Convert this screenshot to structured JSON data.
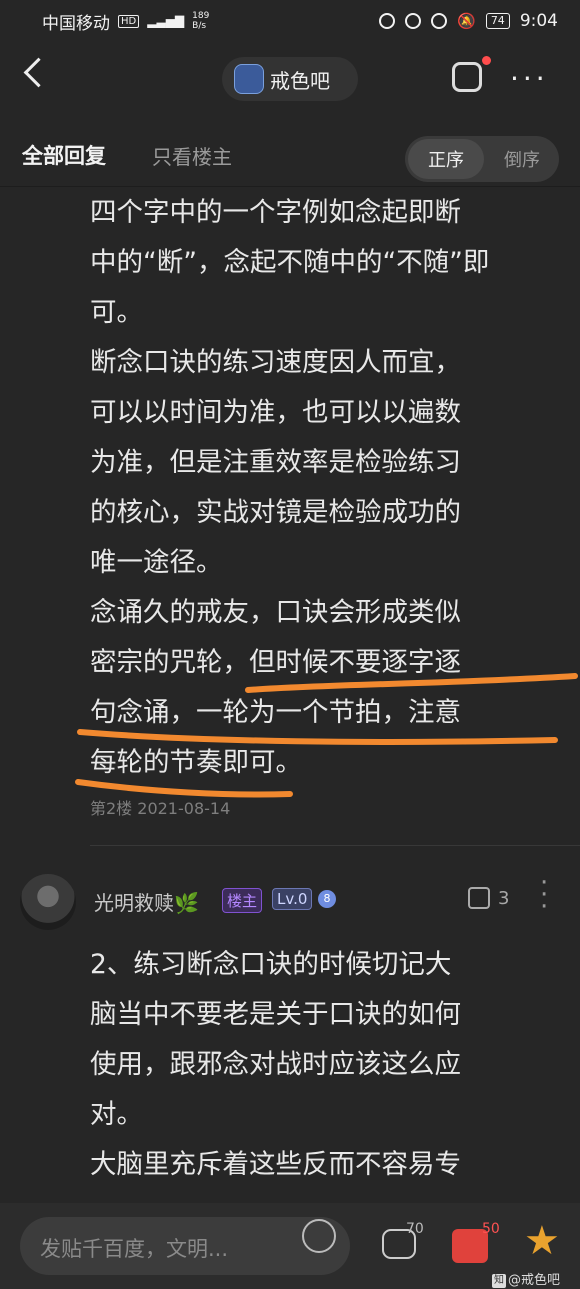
{
  "status_bar": {
    "carrier": "中国移动",
    "hd": "HD",
    "network_speed": "189",
    "network_unit": "B/s",
    "battery": "74",
    "time": "9:04"
  },
  "header": {
    "forum_name": "戒色吧"
  },
  "tabs": {
    "all_replies": "全部回复",
    "op_only": "只看楼主",
    "order_asc": "正序",
    "order_desc": "倒序"
  },
  "post_floor_2": {
    "text": "四个字中的一个字例如念起即断\n中的“断”，念起不随中的“不随”即\n可。\n断念口诀的练习速度因人而宜，\n可以以时间为准，也可以以遍数\n为准，但是注重效率是检验练习\n的核心，实战对镜是检验成功的\n唯一途径。\n念诵久的戒友，口诀会形成类似\n密宗的咒轮，但时候不要逐字逐\n句念诵，一轮为一个节拍，注意\n每轮的节奏即可。",
    "meta": "第2楼  2021-08-14"
  },
  "reply": {
    "username": "光明救赎",
    "badge_op": "楼主",
    "badge_level": "Lv.0",
    "badge_gem": "8",
    "likes": "3",
    "text": "2、练习断念口诀的时候切记大\n脑当中不要老是关于口诀的如何\n使用，跟邪念对战时应该这么应\n对。\n大脑里充斥着这些反而不容易专\n注，容易跑偏，只要把着口诀调"
  },
  "bottom_bar": {
    "input_placeholder": "发贴千百度，文明...",
    "comment_count": "70",
    "like_count": "50"
  },
  "watermark": {
    "icon_text": "知",
    "text": "@戒色吧"
  },
  "annotation": {
    "color": "#f2892f"
  }
}
